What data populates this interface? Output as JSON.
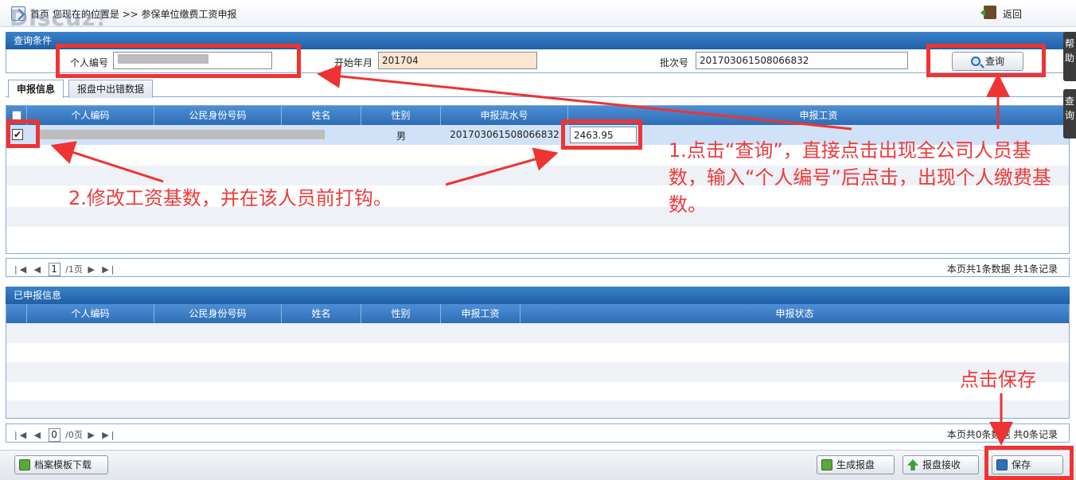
{
  "header": {
    "breadcrumb": "首页  您现在的位置是 >> 参保单位缴费工资申报",
    "watermark": "Discuz!",
    "back_label": "返回"
  },
  "query": {
    "title": "查询条件",
    "emp_no_label": "个人编号",
    "start_label": "开始年月",
    "start_value": "201704",
    "batch_label": "批次号",
    "batch_value": "201703061508066832",
    "query_button": "查询"
  },
  "tabs": [
    {
      "label": "申报信息"
    },
    {
      "label": "报盘中出错数据"
    }
  ],
  "grid1": {
    "columns": [
      "个人编码",
      "公民身份号码",
      "姓名",
      "性别",
      "申报流水号",
      "申报工资"
    ],
    "row": {
      "gender": "男",
      "serial": "201703061508066832",
      "wage": "2463.95"
    },
    "pager": {
      "page": "1",
      "total": "/1页",
      "info": "本页共1条数据 共1条记录"
    }
  },
  "grid2": {
    "title": "已申报信息",
    "columns": [
      "个人编码",
      "公民身份号码",
      "姓名",
      "性别",
      "申报工资",
      "申报状态"
    ],
    "pager": {
      "page": "0",
      "total": "/0页",
      "info": "本页共0条数据 共0条记录"
    }
  },
  "side_tabs": [
    "帮助",
    "查询"
  ],
  "toolbar": {
    "template_button": "档案模板下载",
    "generate_button": "生成报盘",
    "receive_button": "报盘接收",
    "save_button": "保存"
  },
  "annotations": {
    "step1": "1.点击“查询”，直接点击出现全公司人员基数，输入“个人编号”后点击，出现个人缴费基数。",
    "step2": "2.修改工资基数，并在该人员前打钩。",
    "step3": "点击保存"
  },
  "colors": {
    "header_blue": "#2e6db5",
    "annotation_red": "#ef3333",
    "start_input_bg": "#fde6cf"
  }
}
